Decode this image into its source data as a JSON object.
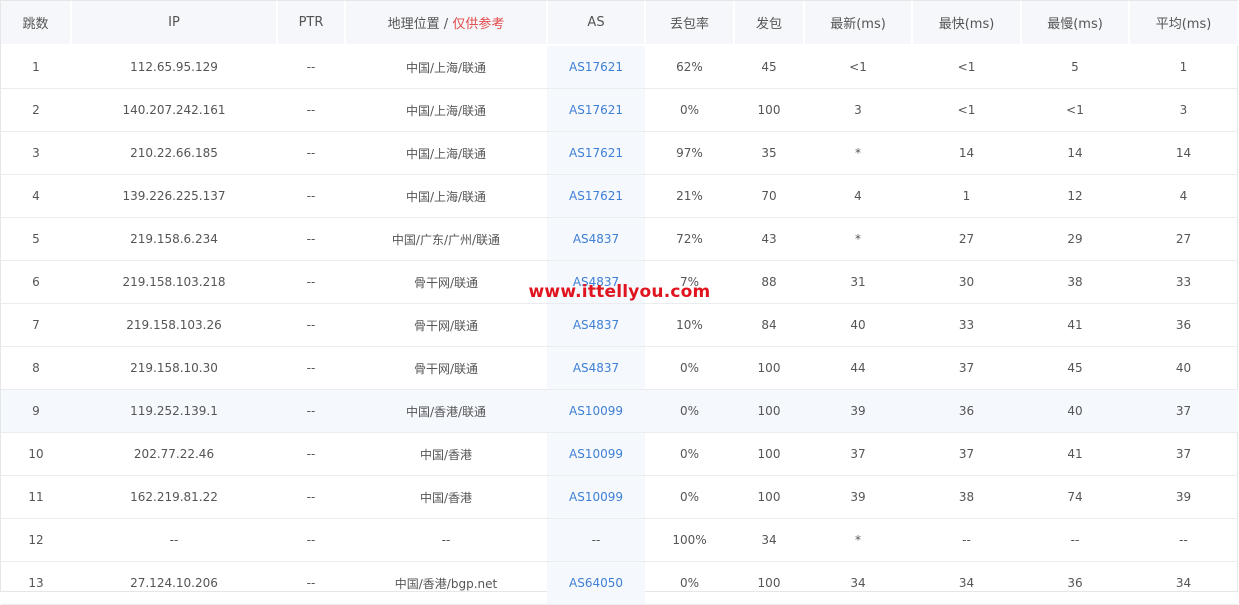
{
  "headers": {
    "hop": "跳数",
    "ip": "IP",
    "ptr": "PTR",
    "geo": "地理位置 / ",
    "geo_note": "仅供参考",
    "as": "AS",
    "loss": "丢包率",
    "sent": "发包",
    "last": "最新(ms)",
    "best": "最快(ms)",
    "worst": "最慢(ms)",
    "avg": "平均(ms)"
  },
  "rows": [
    {
      "hop": "1",
      "ip": "112.65.95.129",
      "ptr": "--",
      "geo": "中国/上海/联通",
      "as": "AS17621",
      "loss": "62%",
      "sent": "45",
      "last": "<1",
      "best": "<1",
      "worst": "5",
      "avg": "1"
    },
    {
      "hop": "2",
      "ip": "140.207.242.161",
      "ptr": "--",
      "geo": "中国/上海/联通",
      "as": "AS17621",
      "loss": "0%",
      "sent": "100",
      "last": "3",
      "best": "<1",
      "worst": "<1",
      "avg": "3"
    },
    {
      "hop": "3",
      "ip": "210.22.66.185",
      "ptr": "--",
      "geo": "中国/上海/联通",
      "as": "AS17621",
      "loss": "97%",
      "sent": "35",
      "last": "*",
      "best": "14",
      "worst": "14",
      "avg": "14"
    },
    {
      "hop": "4",
      "ip": "139.226.225.137",
      "ptr": "--",
      "geo": "中国/上海/联通",
      "as": "AS17621",
      "loss": "21%",
      "sent": "70",
      "last": "4",
      "best": "1",
      "worst": "12",
      "avg": "4"
    },
    {
      "hop": "5",
      "ip": "219.158.6.234",
      "ptr": "--",
      "geo": "中国/广东/广州/联通",
      "as": "AS4837",
      "loss": "72%",
      "sent": "43",
      "last": "*",
      "best": "27",
      "worst": "29",
      "avg": "27"
    },
    {
      "hop": "6",
      "ip": "219.158.103.218",
      "ptr": "--",
      "geo": "骨干网/联通",
      "as": "AS4837",
      "loss": "7%",
      "sent": "88",
      "last": "31",
      "best": "30",
      "worst": "38",
      "avg": "33"
    },
    {
      "hop": "7",
      "ip": "219.158.103.26",
      "ptr": "--",
      "geo": "骨干网/联通",
      "as": "AS4837",
      "loss": "10%",
      "sent": "84",
      "last": "40",
      "best": "33",
      "worst": "41",
      "avg": "36"
    },
    {
      "hop": "8",
      "ip": "219.158.10.30",
      "ptr": "--",
      "geo": "骨干网/联通",
      "as": "AS4837",
      "loss": "0%",
      "sent": "100",
      "last": "44",
      "best": "37",
      "worst": "45",
      "avg": "40"
    },
    {
      "hop": "9",
      "ip": "119.252.139.1",
      "ptr": "--",
      "geo": "中国/香港/联通",
      "as": "AS10099",
      "loss": "0%",
      "sent": "100",
      "last": "39",
      "best": "36",
      "worst": "40",
      "avg": "37"
    },
    {
      "hop": "10",
      "ip": "202.77.22.46",
      "ptr": "--",
      "geo": "中国/香港",
      "as": "AS10099",
      "loss": "0%",
      "sent": "100",
      "last": "37",
      "best": "37",
      "worst": "41",
      "avg": "37"
    },
    {
      "hop": "11",
      "ip": "162.219.81.22",
      "ptr": "--",
      "geo": "中国/香港",
      "as": "AS10099",
      "loss": "0%",
      "sent": "100",
      "last": "39",
      "best": "38",
      "worst": "74",
      "avg": "39"
    },
    {
      "hop": "12",
      "ip": "--",
      "ptr": "--",
      "geo": "--",
      "as": "--",
      "loss": "100%",
      "sent": "34",
      "last": "*",
      "best": "--",
      "worst": "--",
      "avg": "--"
    },
    {
      "hop": "13",
      "ip": "27.124.10.206",
      "ptr": "--",
      "geo": "中国/香港/bgp.net",
      "as": "AS64050",
      "loss": "0%",
      "sent": "100",
      "last": "34",
      "best": "34",
      "worst": "36",
      "avg": "34"
    }
  ],
  "highlighted_row": "9",
  "watermark": "www.ittellyou.com",
  "colors": {
    "header_bg": "#f5f7fa",
    "as_link": "#3f7fd6",
    "note_red": "#e24b4b",
    "watermark_red": "#e0141e"
  }
}
